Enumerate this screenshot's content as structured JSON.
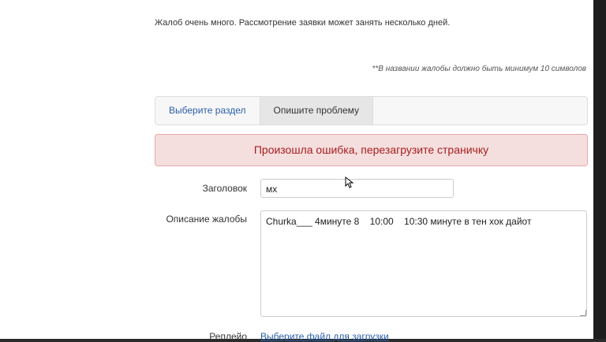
{
  "notice": "Жалоб очень много. Рассмотрение заявки может занять несколько дней.",
  "rule_note": "**В названии жалобы должно быть минимум 10 символов",
  "tabs": [
    {
      "label": "Выберите раздел",
      "active": false
    },
    {
      "label": "Опишите проблему",
      "active": true
    }
  ],
  "alert": "Произошла ошибка, перезагрузите страничку",
  "form": {
    "title_label": "Заголовок",
    "title_value": "мх",
    "description_label": "Описание жалобы",
    "description_value": "Churka___ 4минуте 8    10:00    10:30 минуте в тен хок дайот",
    "evidence_label": "Реплейо",
    "evidence_link": "Выберите файл для загрузки"
  },
  "colors": {
    "link": "#2a5fa8",
    "alert_text": "#a61e1e",
    "alert_bg": "#f5dede",
    "alert_border": "#e8a8ab"
  }
}
